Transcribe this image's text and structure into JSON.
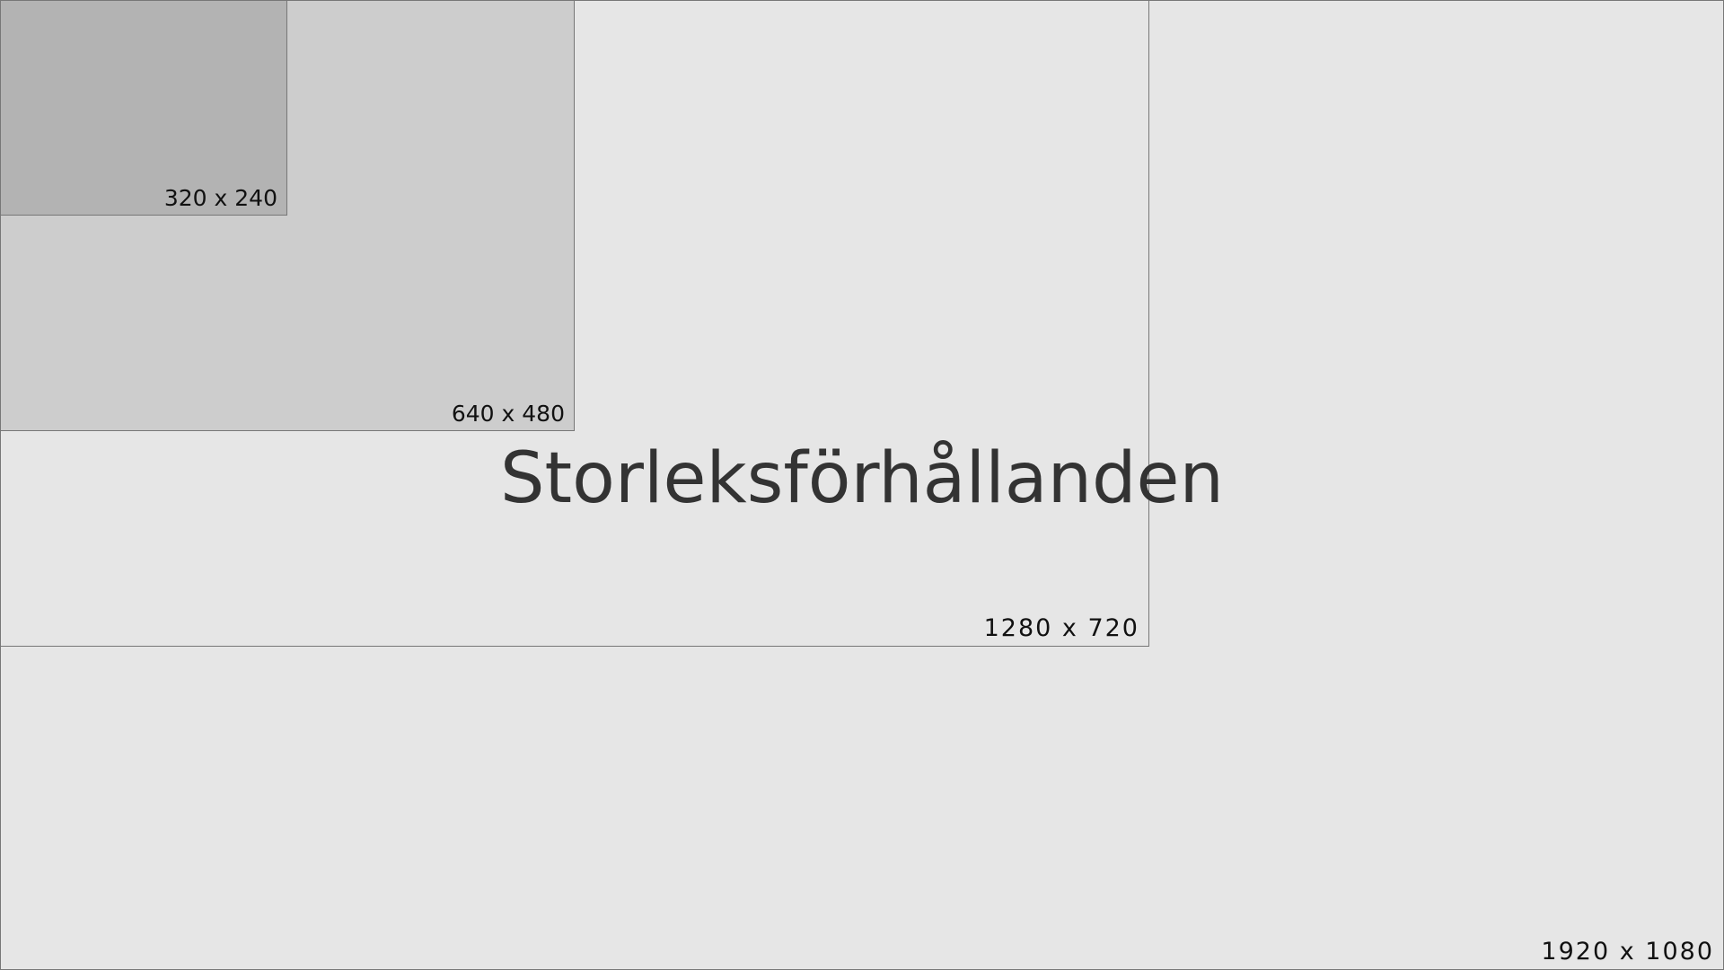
{
  "title": "Storleksförhållanden",
  "boxes": {
    "r1920": "1920 x 1080",
    "r1280": "1280 x 720",
    "r640": "640 x 480",
    "r320": "320 x 240"
  }
}
